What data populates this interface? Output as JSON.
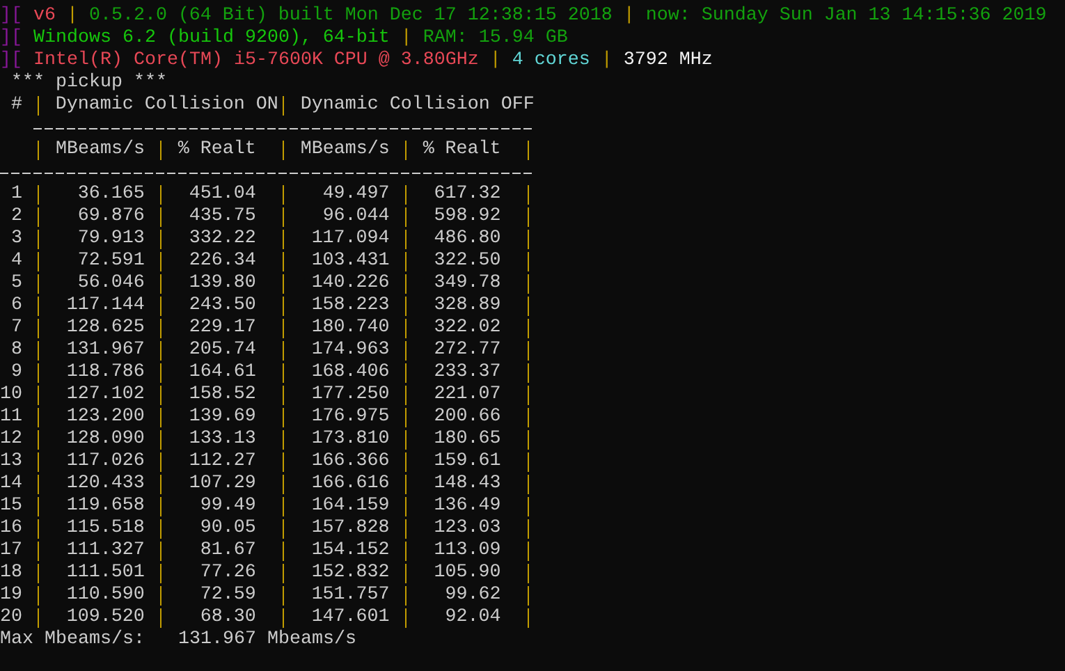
{
  "header_lines": [
    {
      "segments": [
        {
          "text": "][",
          "color": "#881798"
        },
        {
          "text": "v6",
          "color": "#e74856"
        },
        {
          "text": "|",
          "color": "#c19c00"
        },
        {
          "text": "0.5.2.0 (64 Bit) built Mon Dec 17 12:38:15 2018",
          "color": "#13a10e"
        },
        {
          "text": "|",
          "color": "#c19c00"
        },
        {
          "text": "now: Sunday Sun Jan 13 14:15:36 2019",
          "color": "#13a10e"
        }
      ]
    },
    {
      "segments": [
        {
          "text": "][",
          "color": "#881798"
        },
        {
          "text": "Windows 6.2 (build 9200), 64-bit",
          "color": "#16c60c"
        },
        {
          "text": "|",
          "color": "#c19c00"
        },
        {
          "text": "RAM: 15.94 GB",
          "color": "#13a10e"
        }
      ]
    },
    {
      "segments": [
        {
          "text": "][",
          "color": "#881798"
        },
        {
          "text": "Intel(R) Core(TM) i5-7600K CPU @ 3.80GHz",
          "color": "#e74856"
        },
        {
          "text": "|",
          "color": "#c19c00"
        },
        {
          "text": "4 cores",
          "color": "#61d6d6"
        },
        {
          "text": "|",
          "color": "#c19c00"
        },
        {
          "text": "3792 MHz",
          "color": "#f2f2f2"
        }
      ]
    }
  ],
  "section_title": "*** pickup ***",
  "table": {
    "index_header": "#",
    "groups": [
      "Dynamic Collision ON",
      "Dynamic Collision OFF"
    ],
    "columns": [
      "MBeams/s",
      "% Realt",
      "MBeams/s",
      "% Realt"
    ],
    "rows": [
      {
        "index": "1",
        "cells": [
          "36.165",
          "451.04",
          "49.497",
          "617.32"
        ]
      },
      {
        "index": "2",
        "cells": [
          "69.876",
          "435.75",
          "96.044",
          "598.92"
        ]
      },
      {
        "index": "3",
        "cells": [
          "79.913",
          "332.22",
          "117.094",
          "486.80"
        ]
      },
      {
        "index": "4",
        "cells": [
          "72.591",
          "226.34",
          "103.431",
          "322.50"
        ]
      },
      {
        "index": "5",
        "cells": [
          "56.046",
          "139.80",
          "140.226",
          "349.78"
        ]
      },
      {
        "index": "6",
        "cells": [
          "117.144",
          "243.50",
          "158.223",
          "328.89"
        ]
      },
      {
        "index": "7",
        "cells": [
          "128.625",
          "229.17",
          "180.740",
          "322.02"
        ]
      },
      {
        "index": "8",
        "cells": [
          "131.967",
          "205.74",
          "174.963",
          "272.77"
        ]
      },
      {
        "index": "9",
        "cells": [
          "118.786",
          "164.61",
          "168.406",
          "233.37"
        ]
      },
      {
        "index": "10",
        "cells": [
          "127.102",
          "158.52",
          "177.250",
          "221.07"
        ]
      },
      {
        "index": "11",
        "cells": [
          "123.200",
          "139.69",
          "176.975",
          "200.66"
        ]
      },
      {
        "index": "12",
        "cells": [
          "128.090",
          "133.13",
          "173.810",
          "180.65"
        ]
      },
      {
        "index": "13",
        "cells": [
          "117.026",
          "112.27",
          "166.366",
          "159.61"
        ]
      },
      {
        "index": "14",
        "cells": [
          "120.433",
          "107.29",
          "166.616",
          "148.43"
        ]
      },
      {
        "index": "15",
        "cells": [
          "119.658",
          "99.49",
          "164.159",
          "136.49"
        ]
      },
      {
        "index": "16",
        "cells": [
          "115.518",
          "90.05",
          "157.828",
          "123.03"
        ]
      },
      {
        "index": "17",
        "cells": [
          "111.327",
          "81.67",
          "154.152",
          "113.09"
        ]
      },
      {
        "index": "18",
        "cells": [
          "111.501",
          "77.26",
          "152.832",
          "105.90"
        ]
      },
      {
        "index": "19",
        "cells": [
          "110.590",
          "72.59",
          "151.757",
          "99.62"
        ]
      },
      {
        "index": "20",
        "cells": [
          "109.520",
          "68.30",
          "147.601",
          "92.04"
        ]
      }
    ]
  },
  "summary": "Max Mbeams/s:   131.967 Mbeams/s"
}
